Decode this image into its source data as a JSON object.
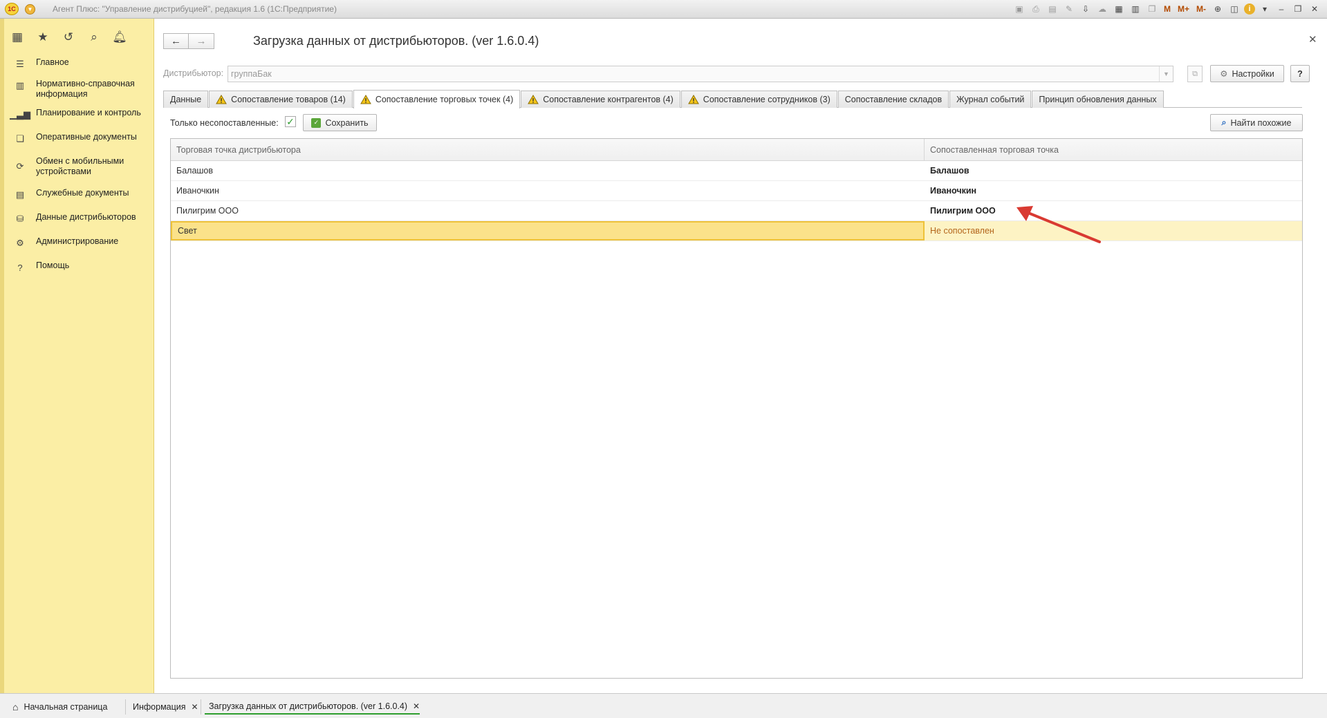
{
  "window": {
    "app_title": "Агент Плюс: \"Управление дистрибуцией\", редакция 1.6  (1С:Предприятие)",
    "toolbar_m": "M",
    "toolbar_mplus": "M+",
    "toolbar_mminus": "M-"
  },
  "sidebar": {
    "items": [
      {
        "label": "Главное",
        "icon": "menu-lines-icon"
      },
      {
        "label": "Нормативно-справочная информация",
        "icon": "catalog-icon"
      },
      {
        "label": "Планирование и контроль",
        "icon": "bar-chart-icon"
      },
      {
        "label": "Оперативные документы",
        "icon": "documents-icon"
      },
      {
        "label": "Обмен с мобильными устройствами",
        "icon": "sync-icon"
      },
      {
        "label": "Служебные документы",
        "icon": "service-docs-icon"
      },
      {
        "label": "Данные дистрибьюторов",
        "icon": "distributor-data-icon"
      },
      {
        "label": "Администрирование",
        "icon": "gear-icon"
      },
      {
        "label": "Помощь",
        "icon": "question-icon"
      }
    ]
  },
  "header": {
    "title": "Загрузка данных от дистрибьюторов. (ver 1.6.0.4)"
  },
  "distributor": {
    "label": "Дистрибьютор:",
    "value": "группаБак",
    "settings_label": "Настройки",
    "help_label": "?"
  },
  "tabs": [
    {
      "label": "Данные",
      "warn": false,
      "active": false
    },
    {
      "label": "Сопоставление товаров (14)",
      "warn": true,
      "active": false
    },
    {
      "label": "Сопоставление торговых точек (4)",
      "warn": true,
      "active": true
    },
    {
      "label": "Сопоставление контрагентов (4)",
      "warn": true,
      "active": false
    },
    {
      "label": "Сопоставление сотрудников (3)",
      "warn": true,
      "active": false
    },
    {
      "label": "Сопоставление складов",
      "warn": false,
      "active": false
    },
    {
      "label": "Журнал событий",
      "warn": false,
      "active": false
    },
    {
      "label": "Принцип обновления данных",
      "warn": false,
      "active": false
    }
  ],
  "toolbar": {
    "only_unmatched_label": "Только несопоставленные:",
    "only_unmatched_checked": true,
    "save_label": "Сохранить",
    "find_similar_label": "Найти похожие"
  },
  "table": {
    "columns": [
      "Торговая точка дистрибьютора",
      "Сопоставленная торговая точка"
    ],
    "rows": [
      {
        "distributor_point": "Балашов",
        "matched_point": "Балашов",
        "selected": false
      },
      {
        "distributor_point": "Иваночкин",
        "matched_point": "Иваночкин",
        "selected": false
      },
      {
        "distributor_point": "Пилигрим ООО",
        "matched_point": "Пилигрим ООО",
        "selected": false
      },
      {
        "distributor_point": "Свет",
        "matched_point": "Не сопоставлен",
        "selected": true
      }
    ]
  },
  "bottom_tabs": [
    {
      "label": "Начальная страница",
      "closable": false,
      "active": false
    },
    {
      "label": "Информация",
      "closable": true,
      "active": false
    },
    {
      "label": "Загрузка данных от дистрибьюторов. (ver 1.6.0.4)",
      "closable": true,
      "active": true
    }
  ],
  "colors": {
    "sidebar_bg": "#fbeea5",
    "selected_row": "#fbe28a",
    "unmatched_text": "#b3651b",
    "annotation_arrow": "#d93a32"
  }
}
